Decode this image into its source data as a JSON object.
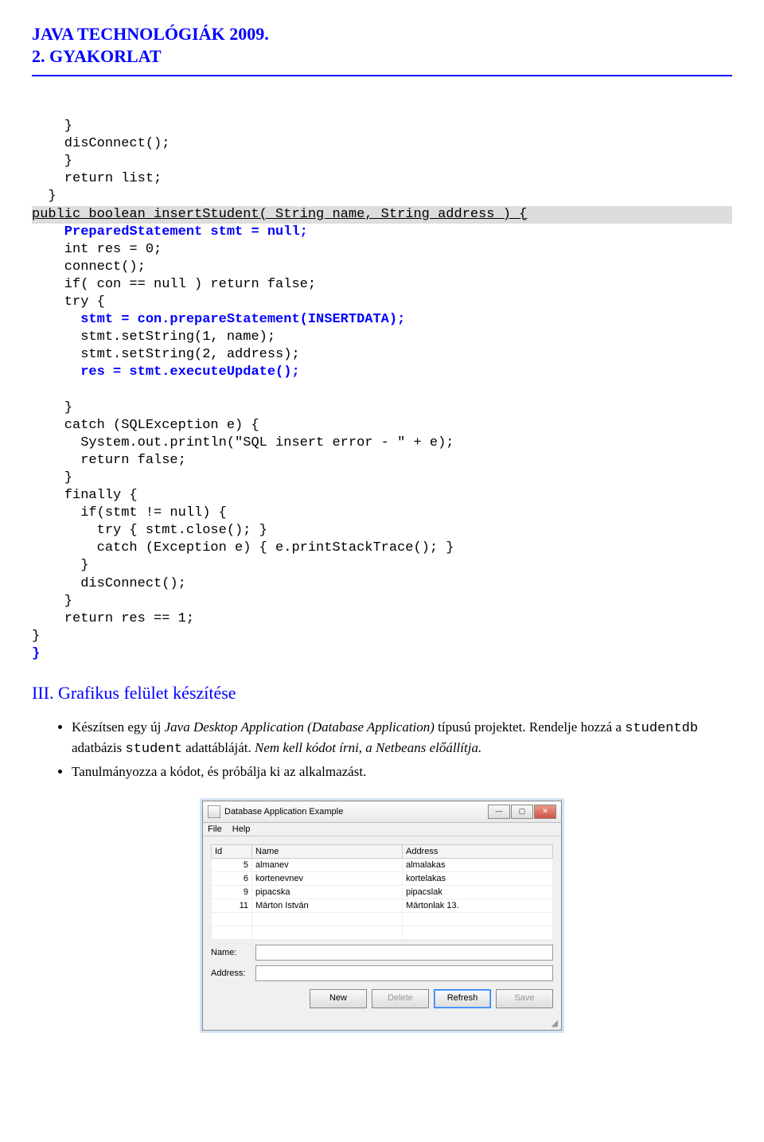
{
  "header": {
    "title": "JAVA TECHNOLÓGIÁK 2009.",
    "subtitle": "2. GYAKORLAT"
  },
  "code": {
    "l1": "    }",
    "l2": "    disConnect();",
    "l3": "    }",
    "l4": "    return list;",
    "l5": "  }",
    "hl": "public boolean insertStudent( String name, String address ) {",
    "l6": "    PreparedStatement stmt = null;",
    "l7": "    int res = 0;",
    "l8": "    connect();",
    "l9": "    if( con == null ) return false;",
    "l10": "    try {",
    "l11": "      stmt = con.prepareStatement(INSERTDATA);",
    "l12": "      stmt.setString(1, name);",
    "l13": "      stmt.setString(2, address);",
    "l14": "      res = stmt.executeUpdate();",
    "l15": "",
    "l16": "    }",
    "l17": "    catch (SQLException e) {",
    "l18": "      System.out.println(\"SQL insert error - \" + e);",
    "l19": "      return false;",
    "l20": "    }",
    "l21": "    finally {",
    "l22": "      if(stmt != null) {",
    "l23": "        try { stmt.close(); }",
    "l24": "        catch (Exception e) { e.printStackTrace(); }",
    "l25": "      }",
    "l26": "      disConnect();",
    "l27": "    }",
    "l28": "    return res == 1;",
    "l29": "}",
    "l30": "}"
  },
  "section3": {
    "heading": "III. Grafikus felület készítése",
    "b1a": "Készítsen egy új ",
    "b1b": "Java Desktop Application (Database Application)",
    "b1c": " típusú projektet. Rendelje hozzá a ",
    "b1d": "studentdb",
    "b1e": "  adatbázis ",
    "b1f": "student",
    "b1g": " adattábláját. ",
    "b1h": "Nem kell kódot írni, a Netbeans előállítja.",
    "b2": "Tanulmányozza a kódot, és próbálja ki az alkalmazást."
  },
  "dialog": {
    "title": "Database Application Example",
    "min": "—",
    "max": "▢",
    "close": "✕",
    "menu_file": "File",
    "menu_help": "Help",
    "cols": {
      "id": "Id",
      "name": "Name",
      "address": "Address"
    },
    "rows": [
      {
        "id": "5",
        "name": "almanev",
        "address": "almalakas"
      },
      {
        "id": "6",
        "name": "kortenevnev",
        "address": "kortelakas"
      },
      {
        "id": "9",
        "name": "pipacska",
        "address": "pipacslak"
      },
      {
        "id": "11",
        "name": "Márton István",
        "address": "Mártonlak 13."
      }
    ],
    "label_name": "Name:",
    "label_address": "Address:",
    "btn_new": "New",
    "btn_delete": "Delete",
    "btn_refresh": "Refresh",
    "btn_save": "Save"
  }
}
